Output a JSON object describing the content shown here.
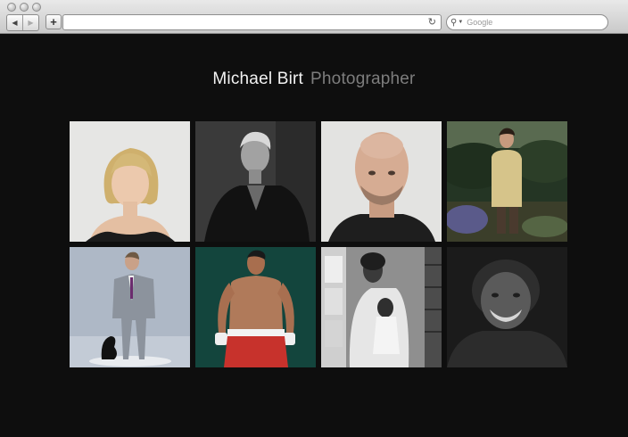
{
  "browser": {
    "back_icon": "back-arrow-icon",
    "forward_icon": "forward-arrow-icon",
    "add_icon": "plus-icon",
    "reload_icon": "reload-icon",
    "search_placeholder": "Google"
  },
  "site": {
    "name": "Michael Birt",
    "role": "Photographer"
  },
  "gallery": [
    {
      "subject": "blonde woman portrait"
    },
    {
      "subject": "older man in dark coat"
    },
    {
      "subject": "bald man portrait"
    },
    {
      "subject": "man in beige coat in garden"
    },
    {
      "subject": "man in grey suit with dog"
    },
    {
      "subject": "boxer with red shorts"
    },
    {
      "subject": "mother and child at window"
    },
    {
      "subject": "smiling older man"
    }
  ],
  "colors": {
    "page_background": "#0e0e0e",
    "title_name": "#f2f2f2",
    "title_role": "#7d7d7d"
  }
}
